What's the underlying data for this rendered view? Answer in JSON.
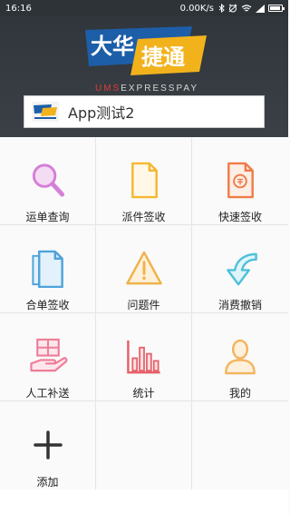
{
  "status_bar": {
    "time": "16:16",
    "network_speed": "0.00K/s",
    "icons": [
      "bluetooth-icon",
      "alarm-icon",
      "wifi-icon",
      "cellular-icon",
      "battery-icon"
    ]
  },
  "header": {
    "logo_text_1": "大华",
    "logo_text_2": "捷通",
    "logo_sub_ums": "UMS",
    "logo_sub_rest": "EXPRESSPAY",
    "account_label": "App测试2",
    "colors": {
      "logo_blue": "#1d5ea8",
      "logo_yellow": "#f2b21c",
      "header_bg": "#33393e"
    }
  },
  "menu": {
    "items": [
      {
        "label": "运单查询",
        "icon": "magnifier-icon",
        "color": "#d57fd9"
      },
      {
        "label": "派件签收",
        "icon": "document-icon",
        "color": "#f5b731"
      },
      {
        "label": "快速签收",
        "icon": "stamp-document-icon",
        "color": "#ef7c4a"
      },
      {
        "label": "合单签收",
        "icon": "stacked-documents-icon",
        "color": "#4fa3db"
      },
      {
        "label": "问题件",
        "icon": "warning-icon",
        "color": "#f0b24a"
      },
      {
        "label": "消费撤销",
        "icon": "undo-arrow-icon",
        "color": "#4fc1d9"
      },
      {
        "label": "人工补送",
        "icon": "hand-package-icon",
        "color": "#ee7d97"
      },
      {
        "label": "统计",
        "icon": "bar-chart-icon",
        "color": "#e6606a"
      },
      {
        "label": "我的",
        "icon": "user-icon",
        "color": "#f4b45e"
      },
      {
        "label": "添加",
        "icon": "plus-icon",
        "color": "#333333"
      }
    ]
  }
}
